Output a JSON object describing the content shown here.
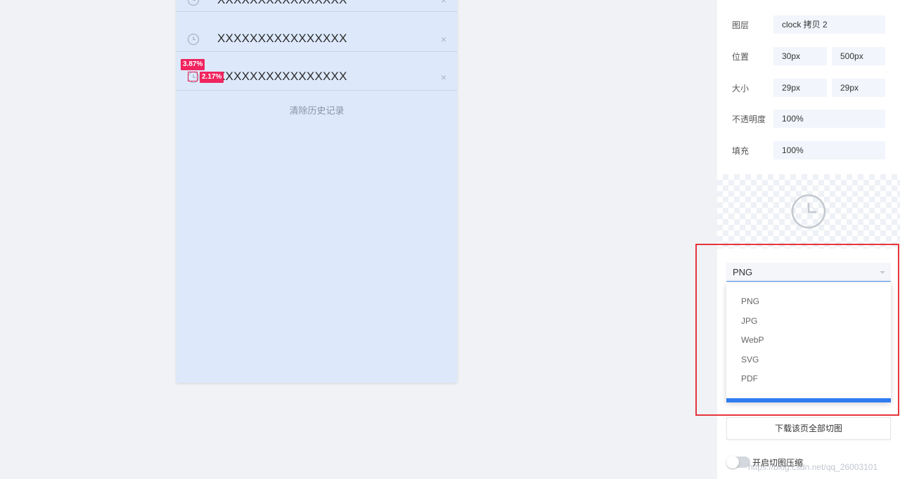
{
  "history": {
    "rows": [
      {
        "text": "XXXXXXXXXXXXXXXX",
        "close": "×"
      },
      {
        "text": "XXXXXXXXXXXXXXXX",
        "close": "×"
      },
      {
        "text": "XXXXXXXXXXXXXXXX",
        "close": "×"
      }
    ],
    "clear_label": "清除历史记录"
  },
  "measure": {
    "vertical": "3.87%",
    "horizontal": "2.17%"
  },
  "properties": {
    "layer_label": "图层",
    "layer_value": "clock 拷贝 2",
    "position_label": "位置",
    "position_x": "30px",
    "position_y": "500px",
    "size_label": "大小",
    "size_w": "29px",
    "size_h": "29px",
    "opacity_label": "不透明度",
    "opacity_value": "100%",
    "fill_label": "填充",
    "fill_value": "100%"
  },
  "preview": {
    "icon": "clock-icon"
  },
  "export": {
    "selected_format": "PNG",
    "options": [
      "PNG",
      "JPG",
      "WebP",
      "SVG",
      "PDF"
    ],
    "download_all_label": "下载该页全部切图",
    "compress_label": "开启切图压缩",
    "compress_enabled": false
  },
  "watermark": "https://blog.csdn.net/qq_26003101",
  "colors": {
    "accent": "#2f7cf0",
    "highlight_frame": "#e5353b",
    "measure_badge": "#f0245e",
    "artboard_bg": "#dde9fb"
  }
}
